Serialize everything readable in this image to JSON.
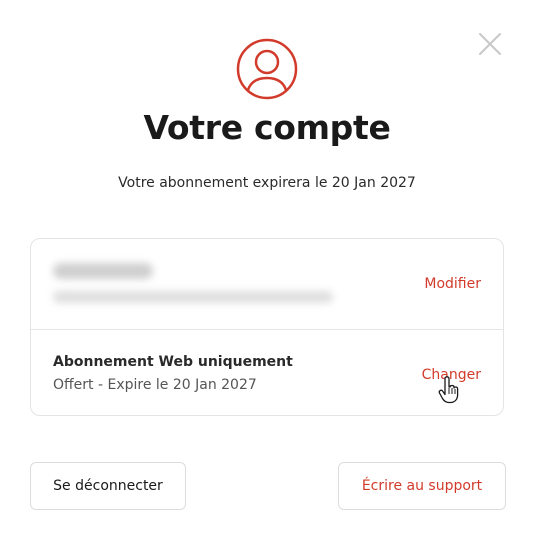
{
  "header": {
    "title": "Votre compte",
    "subtitle": "Votre abonnement expirera le 20 Jan 2027"
  },
  "account": {
    "edit_label": "Modifier"
  },
  "subscription": {
    "plan_name": "Abonnement Web uniquement",
    "plan_detail": "Offert - Expire le 20 Jan 2027",
    "change_label": "Changer"
  },
  "footer": {
    "logout_label": "Se déconnecter",
    "support_label": "Écrire au support"
  },
  "colors": {
    "accent": "#d23b2b",
    "text": "#1a1a1a",
    "border": "#e4e4e4"
  }
}
